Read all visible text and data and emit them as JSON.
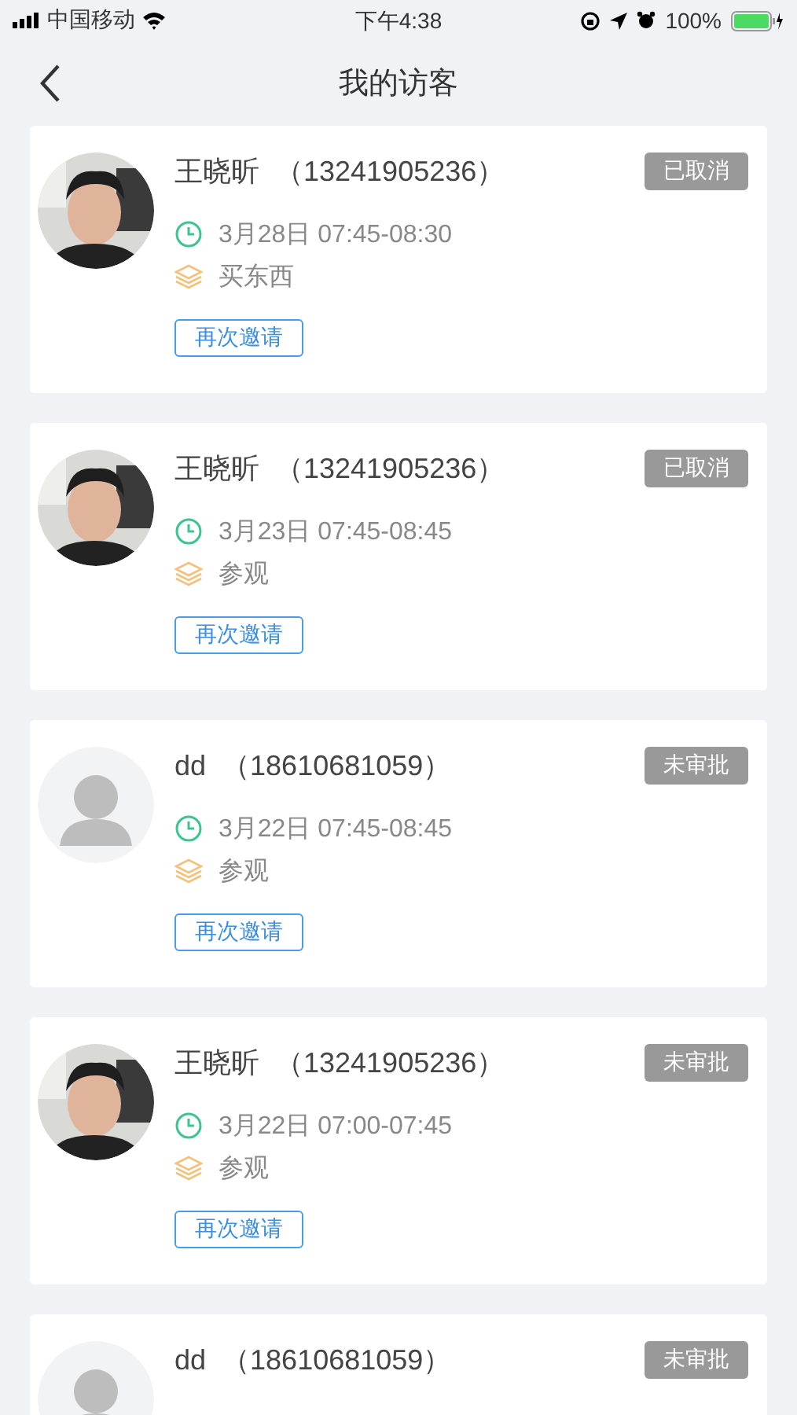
{
  "status_bar": {
    "carrier": "中国移动",
    "time": "下午4:38",
    "battery": "100%"
  },
  "nav": {
    "title": "我的访客"
  },
  "visitors": [
    {
      "kind": "picture",
      "name": "王晓昕",
      "phone": "（13241905236）",
      "status": "已取消",
      "time": "3月28日 07:45-08:30",
      "purpose": "买东西",
      "action": "再次邀请"
    },
    {
      "kind": "picture",
      "name": "王晓昕",
      "phone": "（13241905236）",
      "status": "已取消",
      "time": "3月23日 07:45-08:45",
      "purpose": "参观",
      "action": "再次邀请"
    },
    {
      "kind": "placeholder",
      "name": "dd",
      "phone": "（18610681059）",
      "status": "未审批",
      "time": "3月22日 07:45-08:45",
      "purpose": "参观",
      "action": "再次邀请"
    },
    {
      "kind": "picture",
      "name": "王晓昕",
      "phone": "（13241905236）",
      "status": "未审批",
      "time": "3月22日 07:00-07:45",
      "purpose": "参观",
      "action": "再次邀请"
    },
    {
      "kind": "placeholder",
      "name": "dd",
      "phone": "（18610681059）",
      "status": "未审批"
    }
  ]
}
